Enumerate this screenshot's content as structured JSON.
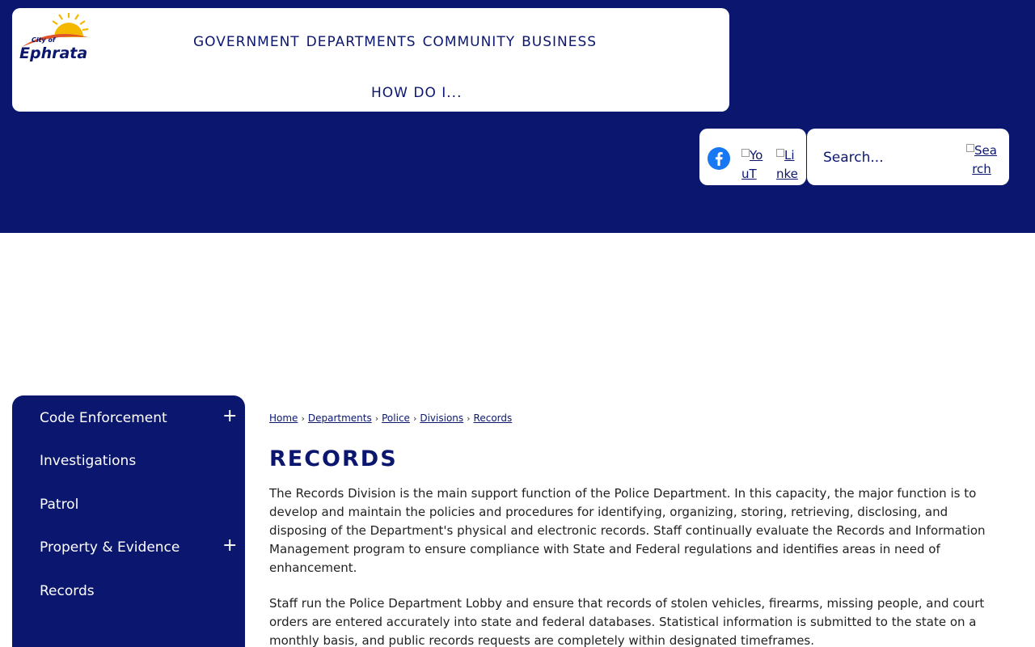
{
  "header": {
    "logo": {
      "small_text": "City of",
      "name": "Ephrata"
    },
    "nav": [
      "GOVERNMENT",
      "DEPARTMENTS",
      "COMMUNITY",
      "BUSINESS"
    ],
    "nav_second": "HOW DO I...",
    "social": {
      "youtube_alt": "YouT",
      "linkedin_alt": "Linke"
    },
    "search": {
      "placeholder": "Search...",
      "button_alt": "Search"
    }
  },
  "sidebar": {
    "items": [
      {
        "label": "Code Enforcement",
        "expand": "+"
      },
      {
        "label": "Investigations"
      },
      {
        "label": "Patrol"
      },
      {
        "label": "Property & Evidence",
        "expand": "+"
      },
      {
        "label": "Records"
      }
    ]
  },
  "breadcrumb": [
    "Home",
    "Departments",
    "Police",
    "Divisions",
    "Records"
  ],
  "breadcrumb_sep": "›",
  "main": {
    "title": "RECORDS",
    "paragraphs": [
      "The Records Division is the main support function of the Police Department. In this capacity, the major function is to develop and maintain the policies and procedures for identifying, organizing, storing, retrieving, disclosing, and disposing of the Department's physical and electronic records. Staff continually evaluate the Records and Information Management program to ensure compliance with State and Federal regulations and identifies areas in need of enhancement.",
      "Staff run the Police Department Lobby and ensure that records of stolen vehicles, firearms, missing people, and court orders are entered accurately into state and federal databases. Statistical information is submitted to the state on a monthly basis, and public records requests are completely within designated timeframes."
    ]
  },
  "colors": {
    "brand": "#0b176e",
    "sun": "#f5b800",
    "swoosh": "#e0522a"
  }
}
